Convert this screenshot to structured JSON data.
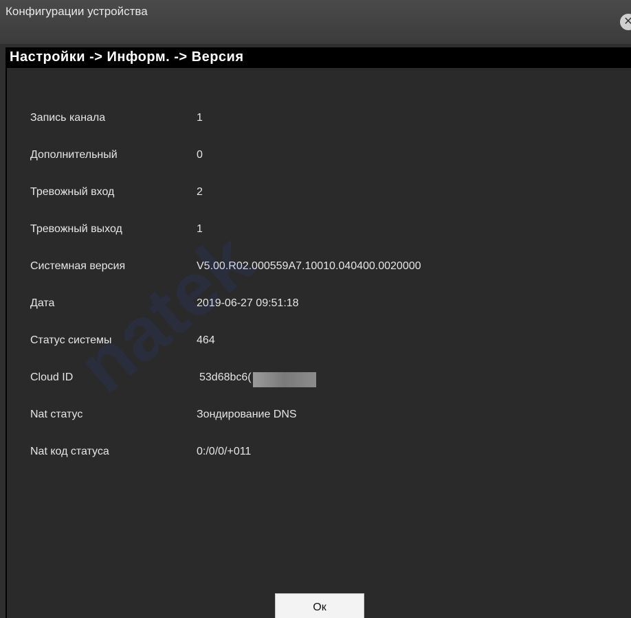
{
  "window": {
    "title": "Конфигурации устройства",
    "close_icon": "close-icon"
  },
  "breadcrumb": "Настройки -> Информ. -> Версия",
  "info": [
    {
      "label": "Запись канала",
      "value": "1"
    },
    {
      "label": "Дополнительный",
      "value": "0"
    },
    {
      "label": "Тревожный вход",
      "value": "2"
    },
    {
      "label": "Тревожный выход",
      "value": "1"
    },
    {
      "label": "Системная версия",
      "value": "V5.00.R02.000559A7.10010.040400.0020000"
    },
    {
      "label": "Дата",
      "value": "2019-06-27 09:51:18"
    },
    {
      "label": "Статус системы",
      "value": "464"
    },
    {
      "label": "Cloud ID",
      "value": "53d68bc6("
    },
    {
      "label": "Nat статус",
      "value": "Зондирование DNS"
    },
    {
      "label": "Nat код статуса",
      "value": "0:/0/0/+011"
    }
  ],
  "ok_button": "Ок",
  "watermark": "natek",
  "colors": {
    "titlebar": "#3f3f3f",
    "content": "#2a2a2a",
    "breadcrumb_bg": "#000000",
    "text": "#e6e6e6"
  }
}
